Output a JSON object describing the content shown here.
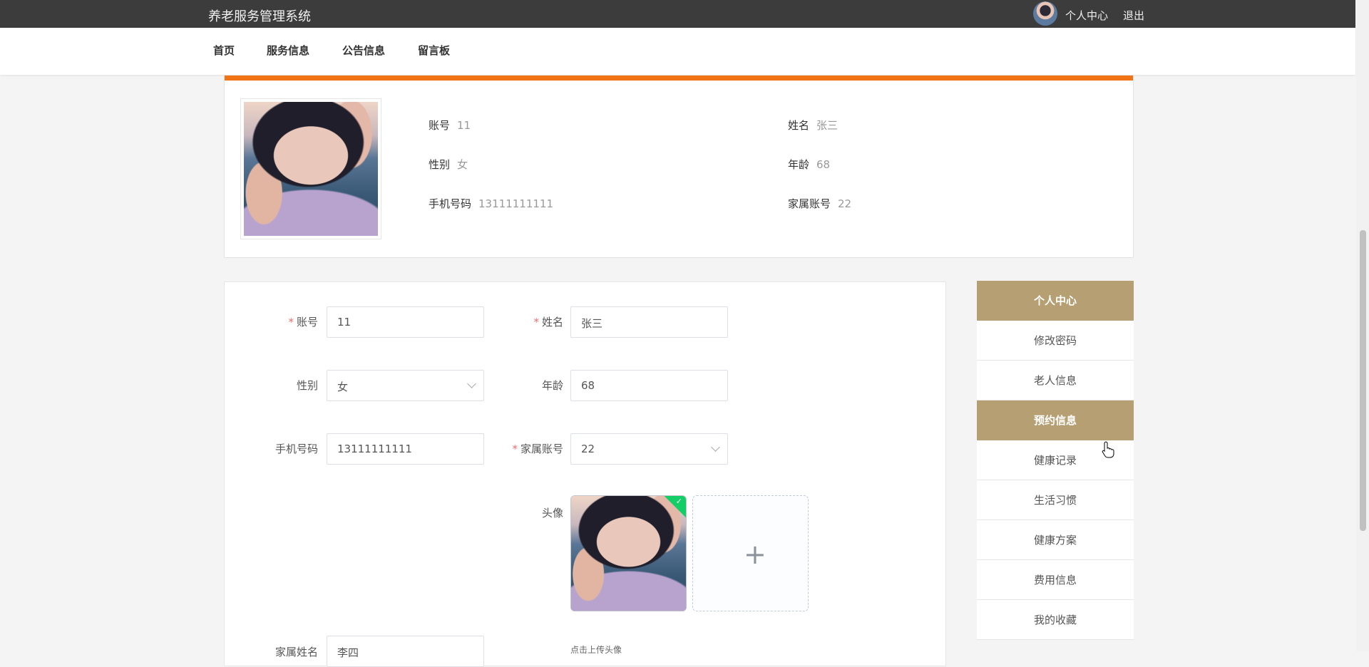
{
  "header": {
    "title": "养老服务管理系统",
    "personal_center": "个人中心",
    "logout": "退出"
  },
  "nav": {
    "items": [
      {
        "label": "首页"
      },
      {
        "label": "服务信息"
      },
      {
        "label": "公告信息"
      },
      {
        "label": "留言板"
      }
    ]
  },
  "profile": {
    "account_label": "账号",
    "account_value": "11",
    "name_label": "姓名",
    "name_value": "张三",
    "gender_label": "性别",
    "gender_value": "女",
    "age_label": "年龄",
    "age_value": "68",
    "phone_label": "手机号码",
    "phone_value": "13111111111",
    "family_account_label": "家属账号",
    "family_account_value": "22",
    "accent_color": "#f07316"
  },
  "form": {
    "required_mark": "*",
    "account": {
      "label": "账号",
      "value": "11"
    },
    "name": {
      "label": "姓名",
      "value": "张三"
    },
    "gender": {
      "label": "性别",
      "value": "女"
    },
    "age": {
      "label": "年龄",
      "value": "68"
    },
    "phone": {
      "label": "手机号码",
      "value": "13111111111"
    },
    "family_account": {
      "label": "家属账号",
      "value": "22"
    },
    "avatar": {
      "label": "头像",
      "upload_icon": "plus-icon",
      "upload_tip": "点击上传头像"
    },
    "family_name": {
      "label": "家属姓名",
      "value": "李四"
    }
  },
  "side_menu": {
    "items": [
      {
        "label": "个人中心",
        "active": true
      },
      {
        "label": "修改密码",
        "active": false
      },
      {
        "label": "老人信息",
        "active": false
      },
      {
        "label": "预约信息",
        "active": true
      },
      {
        "label": "健康记录",
        "active": false
      },
      {
        "label": "生活习惯",
        "active": false
      },
      {
        "label": "健康方案",
        "active": false
      },
      {
        "label": "费用信息",
        "active": false
      },
      {
        "label": "我的收藏",
        "active": false
      }
    ],
    "active_color": "#b59f73"
  }
}
